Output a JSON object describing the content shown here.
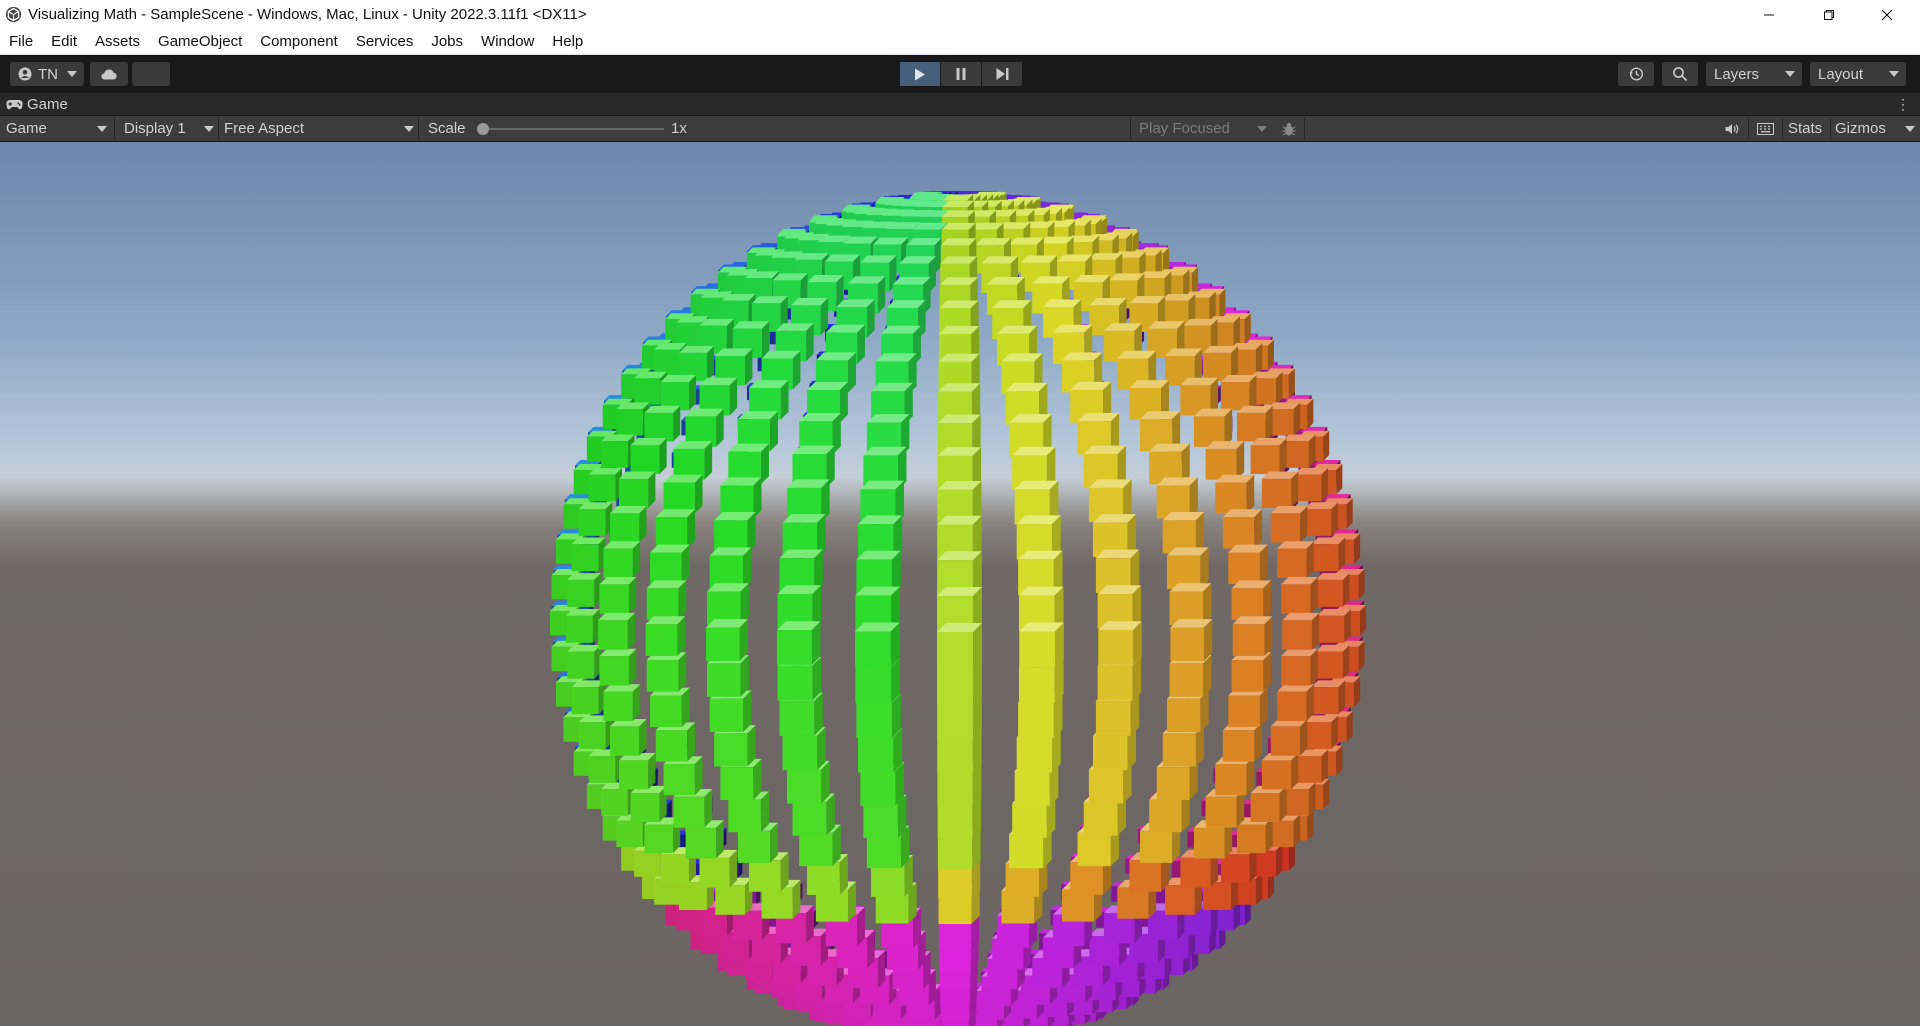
{
  "window": {
    "title": "Visualizing Math - SampleScene - Windows, Mac, Linux - Unity 2022.3.11f1 <DX11>",
    "icon": "unity-logo-icon"
  },
  "menu": [
    "File",
    "Edit",
    "Assets",
    "GameObject",
    "Component",
    "Services",
    "Jobs",
    "Window",
    "Help"
  ],
  "toolbar": {
    "account_label": "TN",
    "cloud_icon": "cloud-icon",
    "play_state": "playing",
    "layers_label": "Layers",
    "layout_label": "Layout"
  },
  "game_tab": {
    "label": "Game"
  },
  "game_controls": {
    "view_label": "Game",
    "display_label": "Display 1",
    "aspect_label": "Free Aspect",
    "scale_label": "Scale",
    "scale_value": "1x",
    "scale_fraction": 0,
    "play_mode_label": "Play Focused",
    "stats_label": "Stats",
    "gizmos_label": "Gizmos"
  },
  "scene": {
    "description_colors": {
      "left": "#2fbf4a",
      "top": "#8ee63a",
      "right": "#f2a64a",
      "bottom": "#d23ac8"
    }
  }
}
